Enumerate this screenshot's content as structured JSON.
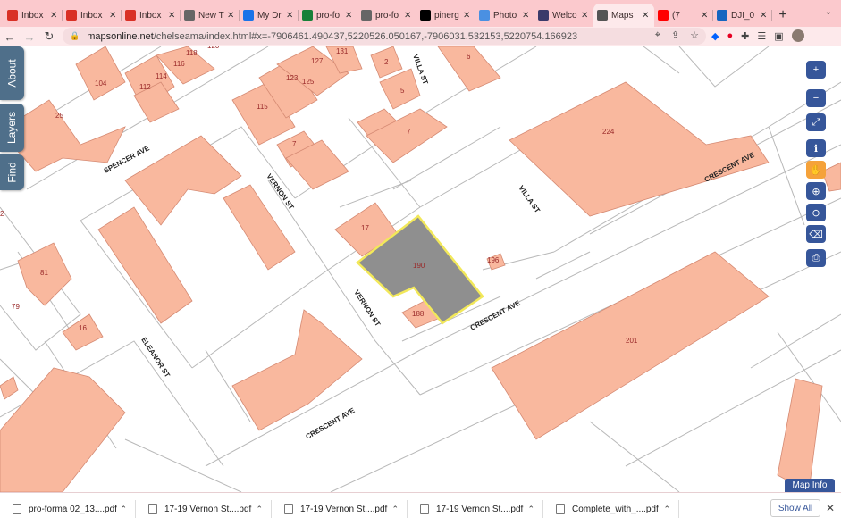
{
  "browser": {
    "tabs": [
      {
        "label": "Inbox",
        "icon": "gmail-icon",
        "color": "#d93025"
      },
      {
        "label": "Inbox",
        "icon": "gmail-icon",
        "color": "#d93025"
      },
      {
        "label": "Inbox",
        "icon": "gmail-icon",
        "color": "#d93025"
      },
      {
        "label": "New T",
        "icon": "globe-icon",
        "color": "#666666"
      },
      {
        "label": "My Dr",
        "icon": "drive-icon",
        "color": "#1a73e8"
      },
      {
        "label": "pro-fo",
        "icon": "sheets-icon",
        "color": "#188038"
      },
      {
        "label": "pro-fo",
        "icon": "globe-icon",
        "color": "#666666"
      },
      {
        "label": "pinerg",
        "icon": "p-icon",
        "color": "#000000"
      },
      {
        "label": "Photo",
        "icon": "photo-icon",
        "color": "#4a90e2"
      },
      {
        "label": "Welco",
        "icon": "app-icon",
        "color": "#3a3a6a"
      },
      {
        "label": "Maps",
        "icon": "globe-icon",
        "color": "#555555",
        "active": true
      },
      {
        "label": "(7",
        "icon": "youtube-icon",
        "color": "#ff0000"
      },
      {
        "label": "DJI_0",
        "icon": "image-icon",
        "color": "#1565c0"
      }
    ],
    "url_domain": "mapsonline.net",
    "url_path": "/chelseama/index.html#x=-7906461.490437,5220526.050167,-7906031.532153,5220754.166923"
  },
  "side_tabs": [
    "About",
    "Layers",
    "Find"
  ],
  "map_info": "Map Info",
  "map": {
    "streets": [
      "SPENCER AVE",
      "VERNON ST",
      "VILLA ST",
      "CRESCENT AVE",
      "CRESCENT AVE",
      "ELEANOR ST",
      "VERNON ST",
      "CRESCENT AVE",
      "VILLA ST"
    ],
    "parcels": [
      "104",
      "112",
      "114",
      "116",
      "118",
      "120",
      "123",
      "125",
      "127",
      "131",
      "2",
      "6",
      "5",
      "7",
      "7",
      "115",
      "25",
      "224",
      "17",
      "190",
      "196",
      "188",
      "81",
      "79",
      "16",
      "201",
      "2"
    ],
    "selected_color": "#8f8f8f",
    "selected_outline": "#f2e85a",
    "building_color": "#f9b89e"
  },
  "downloads": [
    {
      "label": "pro-forma 02_13....pdf"
    },
    {
      "label": "17-19 Vernon St....pdf"
    },
    {
      "label": "17-19 Vernon St....pdf"
    },
    {
      "label": "17-19 Vernon St....pdf"
    },
    {
      "label": "Complete_with_....pdf"
    }
  ],
  "show_all": "Show All"
}
